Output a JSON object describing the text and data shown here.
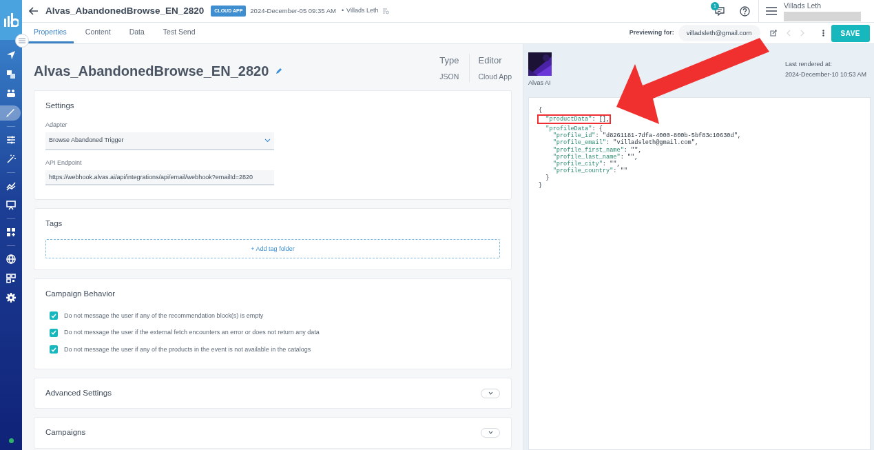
{
  "header": {
    "title": "Alvas_AbandonedBrowse_EN_2820",
    "badge": "CLOUD APP",
    "date": "2024-December-05 09:35 AM",
    "separator": "•",
    "author": "Villads Leth",
    "notification_count": "1",
    "user_name": "Villads Leth"
  },
  "sidebar": {
    "items": [
      {
        "kind": "send",
        "selected": false
      },
      {
        "kind": "layers",
        "selected": false
      },
      {
        "kind": "people",
        "selected": false
      },
      {
        "kind": "brush",
        "selected": true
      },
      {
        "kind": "divider"
      },
      {
        "kind": "sliders",
        "selected": false
      },
      {
        "kind": "wand",
        "selected": false
      },
      {
        "kind": "divider"
      },
      {
        "kind": "trend",
        "selected": false
      },
      {
        "kind": "board",
        "selected": false
      },
      {
        "kind": "divider"
      },
      {
        "kind": "grid",
        "selected": false
      },
      {
        "kind": "divider"
      },
      {
        "kind": "globe",
        "selected": false
      },
      {
        "kind": "qr",
        "selected": false
      },
      {
        "kind": "gear",
        "selected": false
      }
    ]
  },
  "tabs": [
    {
      "label": "Properties",
      "selected": true
    },
    {
      "label": "Content",
      "selected": false
    },
    {
      "label": "Data",
      "selected": false
    },
    {
      "label": "Test Send",
      "selected": false
    }
  ],
  "preview_bar": {
    "label": "Previewing for:",
    "email": "villadsleth@gmail.com",
    "save": "SAVE"
  },
  "template": {
    "name": "Alvas_AbandonedBrowse_EN_2820",
    "meta": [
      {
        "label": "Type",
        "value": "JSON"
      },
      {
        "label": "Editor",
        "value": "Cloud App"
      }
    ]
  },
  "settings": {
    "title": "Settings",
    "fields": [
      {
        "kind": "select",
        "label": "Adapter",
        "value": "Browse Abandoned Trigger"
      },
      {
        "kind": "text",
        "label": "API Endpoint",
        "value": "https://webhook.alvas.ai/api/integrations/api/email/webhook?emailId=2820"
      }
    ]
  },
  "tags": {
    "title": "Tags",
    "add": "+ Add tag folder"
  },
  "behavior": {
    "title": "Campaign Behavior",
    "options": [
      {
        "label": "Do not message the user if any of the recommendation block(s) is empty",
        "checked": true
      },
      {
        "label": "Do not message the user if the external fetch encounters an error or does not return any data",
        "checked": true
      },
      {
        "label": "Do not message the user if any of the products in the event is not available in the catalogs",
        "checked": true
      }
    ]
  },
  "sections": [
    {
      "title": "Advanced Settings",
      "expanded": false
    },
    {
      "title": "Campaigns",
      "expanded": false
    }
  ],
  "preview": {
    "app_name": "Alvas AI",
    "rendered_label": "Last rendered at:",
    "rendered_at": "2024-December-10 10:53 AM",
    "code": [
      {
        "text": "{",
        "highlighted": false
      },
      {
        "text": "  \"productData\": [],",
        "highlighted": true
      },
      {
        "text": "  \"profileData\": {",
        "highlighted": false
      },
      {
        "text": "    \"profile_id\": \"d8261181-7dfa-4000-800b-5bf83c10630d\",",
        "highlighted": false
      },
      {
        "text": "    \"profile_email\": \"villadsleth@gmail.com\",",
        "highlighted": false
      },
      {
        "text": "    \"profile_first_name\": \"\",",
        "highlighted": false
      },
      {
        "text": "    \"profile_last_name\": \"\",",
        "highlighted": false
      },
      {
        "text": "    \"profile_city\": \"\",",
        "highlighted": false
      },
      {
        "text": "    \"profile_country\": \"\"",
        "highlighted": false
      },
      {
        "text": "  }",
        "highlighted": false
      },
      {
        "text": "}",
        "highlighted": false
      }
    ]
  }
}
